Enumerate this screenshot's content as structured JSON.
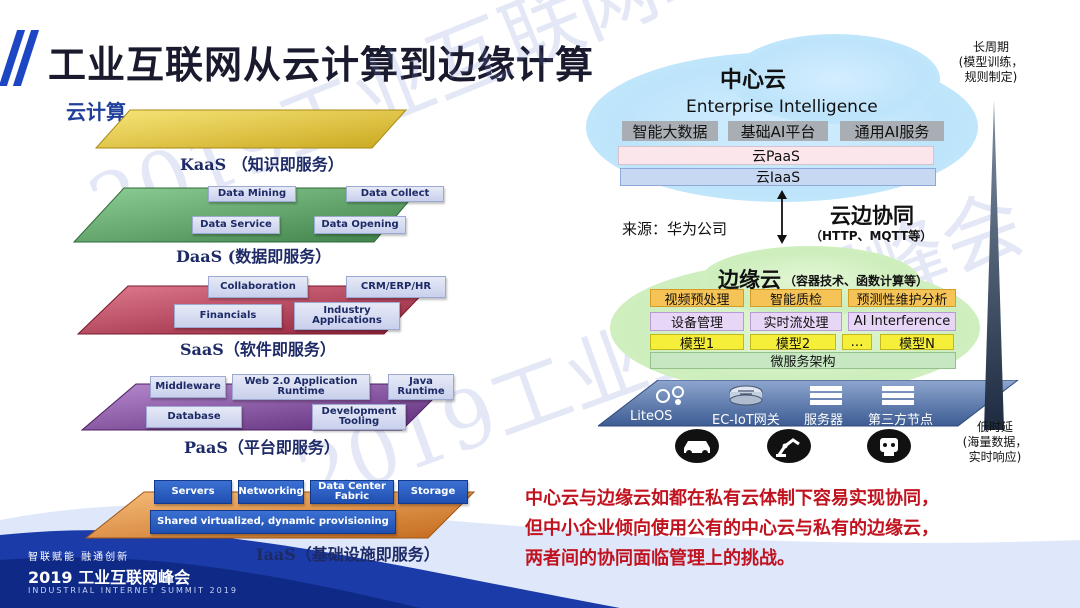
{
  "title": "工业互联网从云计算到边缘计算",
  "cloud_calc_label": "云计算",
  "watermark": "2019工业互联网峰会",
  "kaas": {
    "label": "KaaS （知识即服务）"
  },
  "daas": {
    "label": "DaaS (数据即服务）",
    "chips": [
      "Data Mining",
      "Data Collect",
      "Data Service",
      "Data Opening"
    ]
  },
  "saas": {
    "label": "SaaS（软件即服务）",
    "chips": [
      "Collaboration",
      "CRM/ERP/HR",
      "Financials",
      "Industry Applications"
    ]
  },
  "paas": {
    "label": "PaaS（平台即服务）",
    "chips": [
      "Middleware",
      "Web 2.0 Application Runtime",
      "Java Runtime",
      "Database",
      "Development Tooling"
    ]
  },
  "iaas": {
    "label": "IaaS（基础设施即服务）",
    "chips": [
      "Servers",
      "Networking",
      "Data Center Fabric",
      "Storage"
    ],
    "bar": "Shared virtualized, dynamic provisioning"
  },
  "central_cloud": {
    "title": "中心云",
    "subtitle": "Enterprise Intelligence",
    "services": [
      "智能大数据",
      "基础AI平台",
      "通用AI服务"
    ],
    "paas": "云PaaS",
    "iaas": "云IaaS"
  },
  "collab": {
    "source": "来源：华为公司",
    "title": "云边协同",
    "protocol": "（HTTP、MQTT等）"
  },
  "edge_cloud": {
    "title": "边缘云",
    "subtitle": "（容器技术、函数计算等）",
    "row1": [
      "视频预处理",
      "智能质检",
      "预测性维护分析"
    ],
    "row2": [
      "设备管理",
      "实时流处理",
      "AI Interference"
    ],
    "row3": [
      "模型1",
      "模型2",
      "…",
      "模型N"
    ],
    "base": "微服务架构"
  },
  "devices": [
    "LiteOS",
    "EC-IoT网关",
    "服务器",
    "第三方节点"
  ],
  "side_top": [
    "长周期",
    "(模型训练，",
    "规则制定)"
  ],
  "side_bottom": [
    "低时延",
    "(海量数据，",
    "实时响应)"
  ],
  "conclusion": [
    "中心云与边缘云如都在私有云体制下容易实现协同，",
    "但中小企业倾向使用公有的中心云与私有的边缘云，",
    "两者间的协同面临管理上的挑战。"
  ],
  "footer": {
    "slogan": "智联赋能    融通创新",
    "event": "2019 工业互联网峰会",
    "event_en": "INDUSTRIAL INTERNET SUMMIT 2019"
  },
  "colors": {
    "title": "#1a1a2e",
    "accent_blue": "#1d46c4",
    "conclusion_red": "#c0131f",
    "kaas_layer": "#e8d24a",
    "daas_layer": "#4c9a5a",
    "saas_layer": "#b7344b",
    "paas_layer": "#7d3f98",
    "iaas_layer": "#e98f34"
  }
}
